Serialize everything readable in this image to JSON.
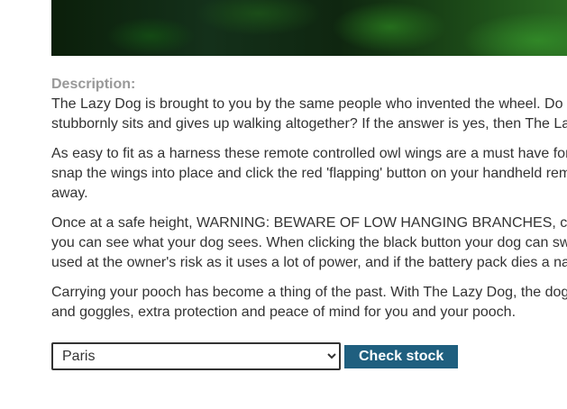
{
  "description": {
    "label": "Description:",
    "paragraphs": [
      [
        "The Lazy Dog is brought to you by the same people who invented the wheel. Do",
        "stubbornly sits and gives up walking altogether? If the answer is yes, then The La"
      ],
      [
        "As easy to fit as a harness these remote controlled owl wings are a must have for",
        "snap the wings into place and click the red 'flapping' button on your handheld rem",
        "away."
      ],
      [
        "Once at a safe height, WARNING: BEWARE OF LOW HANGING BRANCHES, c",
        "you can see what your dog sees. When clicking the black button your dog can sw",
        "used at the owner's risk as it uses a lot of power, and if the battery pack dies a na"
      ],
      [
        "Carrying your pooch has become a thing of the past. With The Lazy Dog, the dog",
        "and goggles, extra protection and peace of mind for you and your pooch."
      ]
    ]
  },
  "stock": {
    "selected_store": "Paris",
    "button_label": "Check stock"
  }
}
